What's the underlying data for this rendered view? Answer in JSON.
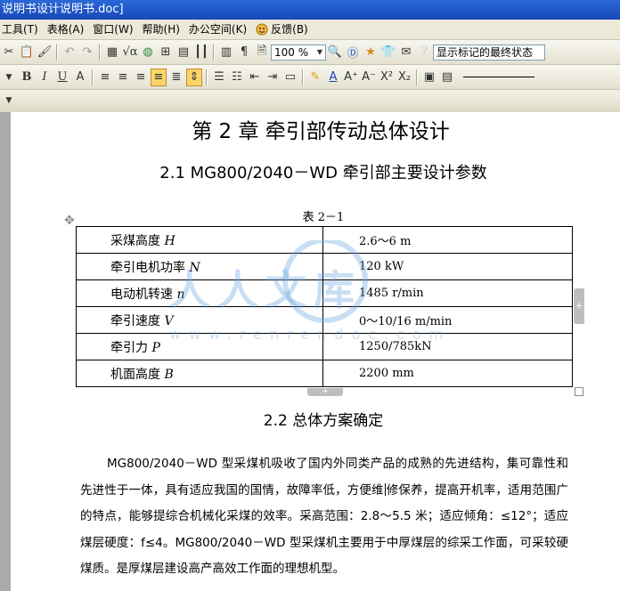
{
  "window": {
    "title": "说明书设计说明书.doc]"
  },
  "menu": [
    {
      "label": "工具(T)"
    },
    {
      "label": "表格(A)"
    },
    {
      "label": "窗口(W)"
    },
    {
      "label": "帮助(H)"
    },
    {
      "label": "办公空间(K)"
    },
    {
      "label": "反馈(B)",
      "icon": "feedback-icon"
    }
  ],
  "toolbar": {
    "zoom": "100 %",
    "markup_mode": "显示标记的最终状态",
    "font_buttons": {
      "bold": "B",
      "italic": "I",
      "underline": "U",
      "superscript": "X²",
      "subscript": "X₂"
    }
  },
  "document": {
    "chapter_title": "第 2 章  牵引部传动总体设计",
    "section_1_title": "2.1 MG800/2040－WD 牵引部主要设计参数",
    "table_caption": "表 2－1",
    "table_rows": [
      {
        "label": "采煤高度 ",
        "symbol": "H",
        "value": "2.6～6 m"
      },
      {
        "label": "牵引电机功率 ",
        "symbol": "N",
        "value": "120 kW"
      },
      {
        "label": "电动机转速 ",
        "symbol": "n",
        "value": "1485 r/min"
      },
      {
        "label": "牵引速度 ",
        "symbol": "V",
        "value": "0～10/16 m/min"
      },
      {
        "label": "牵引力 ",
        "symbol": "P",
        "value": "1250/785kN"
      },
      {
        "label": "机面高度 ",
        "symbol": "B",
        "value": "2200 mm"
      }
    ],
    "section_2_title": "2.2  总体方案确定",
    "paragraph_before_cursor": "MG800/2040－WD 型采煤机吸收了国内外同类产品的成熟的先进结构，集可靠性和先进性于一体，具有适应我国的国情，故障率低，方便维",
    "paragraph_after_cursor": "修保养，提高开机率，适用范围广的特点，能够提综合机械化采煤的效率。采高范围：2.8～5.5 米；适应倾角：≤12°；适应煤层硬度：f≤4。MG800/2040－WD 型采煤机主要用于中厚煤层的综采工作面，可采较硬煤质。是厚煤层建设高产高效工作面的理想机型。"
  },
  "watermark": {
    "text": "人人文库",
    "url": "www.renrendoc.com"
  }
}
